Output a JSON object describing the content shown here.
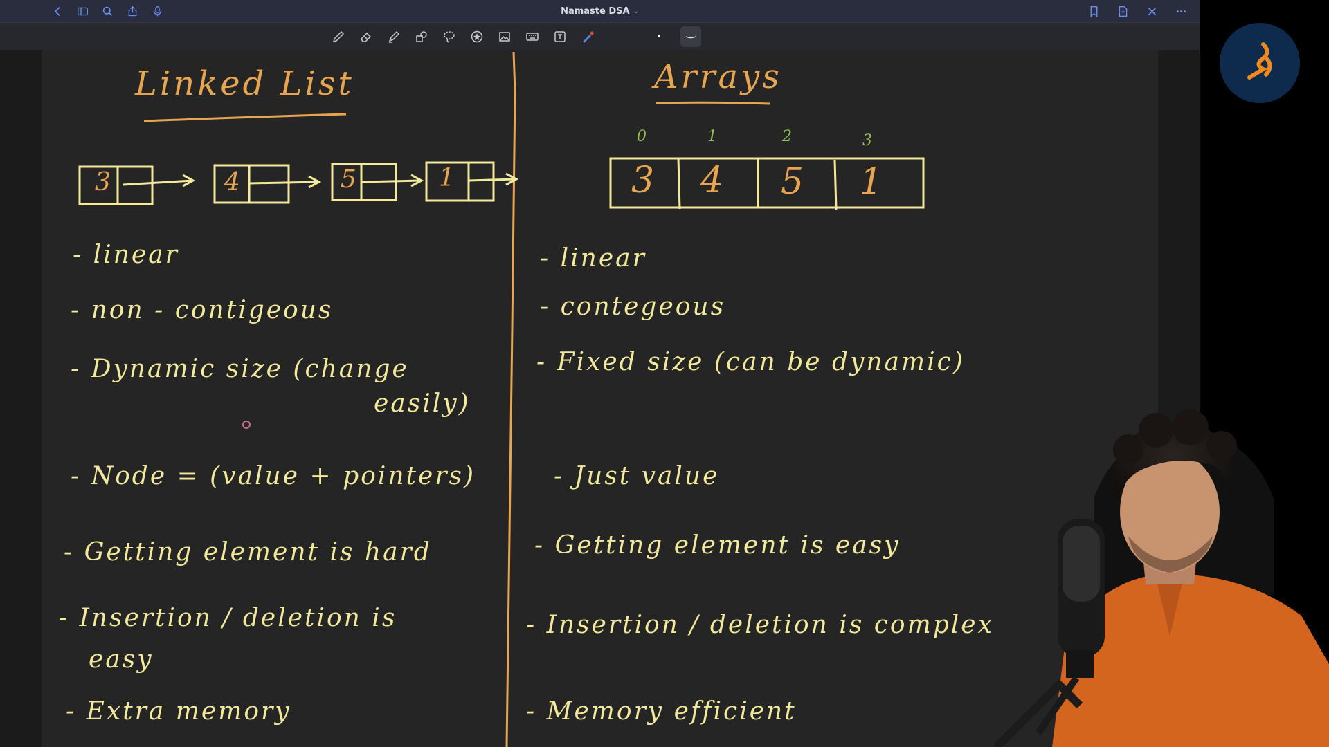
{
  "window": {
    "title": "Namaste DSA",
    "title_chevron": "⌄"
  },
  "titlebar_left_icons": [
    "back-icon",
    "sidebar-icon",
    "search-icon",
    "share-icon",
    "microphone-icon"
  ],
  "titlebar_right_icons": [
    "bookmark-icon",
    "add-page-icon",
    "close-icon",
    "more-icon"
  ],
  "toolbar": {
    "tools": [
      "pen-icon",
      "eraser-icon",
      "highlighter-icon",
      "shapes-icon",
      "lasso-icon",
      "sticker-icon",
      "image-icon",
      "keyboard-icon",
      "text-box-icon",
      "laser-pointer-icon"
    ],
    "selected_tool": "stroke-style"
  },
  "notes": {
    "left": {
      "title": "Linked List",
      "nodes": [
        "3",
        "4",
        "5",
        "1"
      ],
      "points": [
        "- linear",
        "- non - contigeous",
        "- Dynamic size (change",
        "easily)",
        "- Node = (value + pointers)",
        "- Getting element is hard",
        "- Insertion / deletion is",
        "easy",
        "- Extra memory"
      ]
    },
    "right": {
      "title": "Arrays",
      "indices": [
        "0",
        "1",
        "2",
        "3"
      ],
      "values": [
        "3",
        "4",
        "5",
        "1"
      ],
      "points": [
        "- linear",
        "- contegeous",
        "- Fixed size (can be dynamic)",
        "- Just value",
        "- Getting element is easy",
        "- Insertion / deletion is complex",
        "- Memory efficient"
      ]
    }
  },
  "colors": {
    "ink_yellow": "#f2e99a",
    "ink_orange": "#e7a550",
    "ink_green": "#8fbf4d",
    "canvas": "#252526",
    "titlebar": "#2a2d3e",
    "icon_blue": "#6b8ff0"
  }
}
